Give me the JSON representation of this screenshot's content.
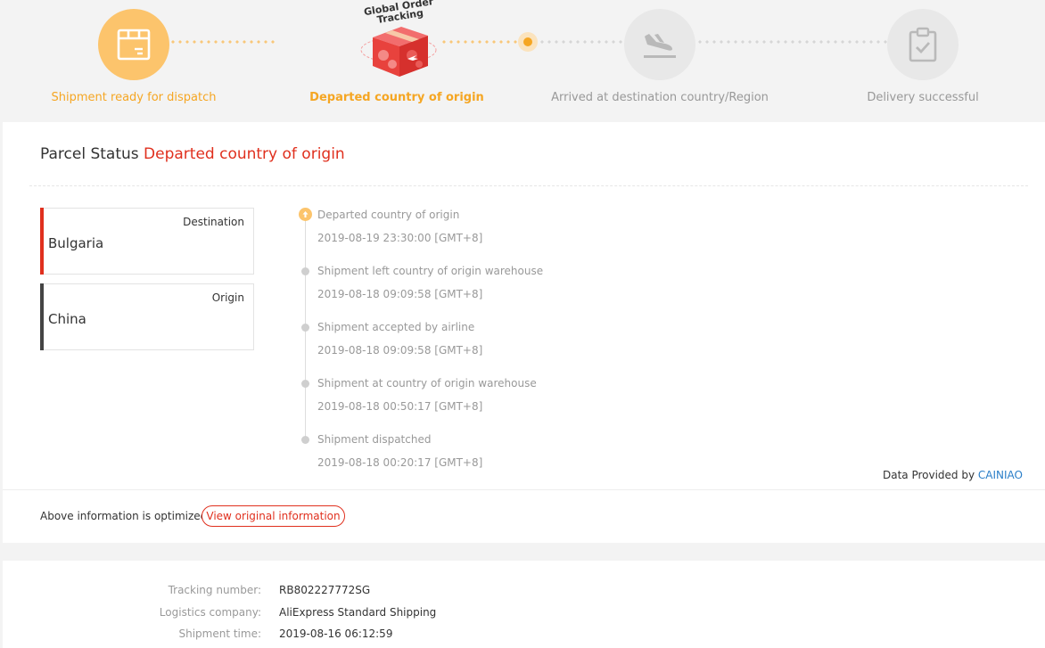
{
  "progress": {
    "badge_title": "Global Order Tracking",
    "steps": [
      {
        "label": "Shipment ready for dispatch",
        "icon": "package-icon",
        "state": "done"
      },
      {
        "label": "Departed country of origin",
        "icon": "global-order-tracking-badge",
        "state": "current"
      },
      {
        "label": "Arrived at destination country/Region",
        "icon": "airplane-landing-icon",
        "state": "pending"
      },
      {
        "label": "Delivery successful",
        "icon": "clipboard-check-icon",
        "state": "pending"
      }
    ]
  },
  "status": {
    "prefix": "Parcel Status",
    "value": "Departed country of origin"
  },
  "locations": {
    "destination": {
      "tag": "Destination",
      "name": "Bulgaria"
    },
    "origin": {
      "tag": "Origin",
      "name": "China"
    }
  },
  "timeline": [
    {
      "event": "Departed country of origin",
      "time": "2019-08-19 23:30:00 [GMT+8]"
    },
    {
      "event": "Shipment left country of origin warehouse",
      "time": "2019-08-18 09:09:58 [GMT+8]"
    },
    {
      "event": "Shipment accepted by airline",
      "time": "2019-08-18 09:09:58 [GMT+8]"
    },
    {
      "event": "Shipment at country of origin warehouse",
      "time": "2019-08-18 00:50:17 [GMT+8]"
    },
    {
      "event": "Shipment dispatched",
      "time": "2019-08-18 00:20:17 [GMT+8]"
    }
  ],
  "provider": {
    "prefix": "Data Provided by",
    "name": "CAINIAO"
  },
  "footer": {
    "optimized_text": "Above information is optimized",
    "view_original_label": "View original information"
  },
  "info": [
    {
      "label": "Tracking number:",
      "value": "RB802227772SG"
    },
    {
      "label": "Logistics company:",
      "value": "AliExpress Standard Shipping"
    },
    {
      "label": "Shipment time:",
      "value": "2019-08-16 06:12:59"
    }
  ],
  "colors": {
    "accent_orange": "#f5a623",
    "status_red": "#e0301e",
    "link_blue": "#2a7ec8"
  }
}
